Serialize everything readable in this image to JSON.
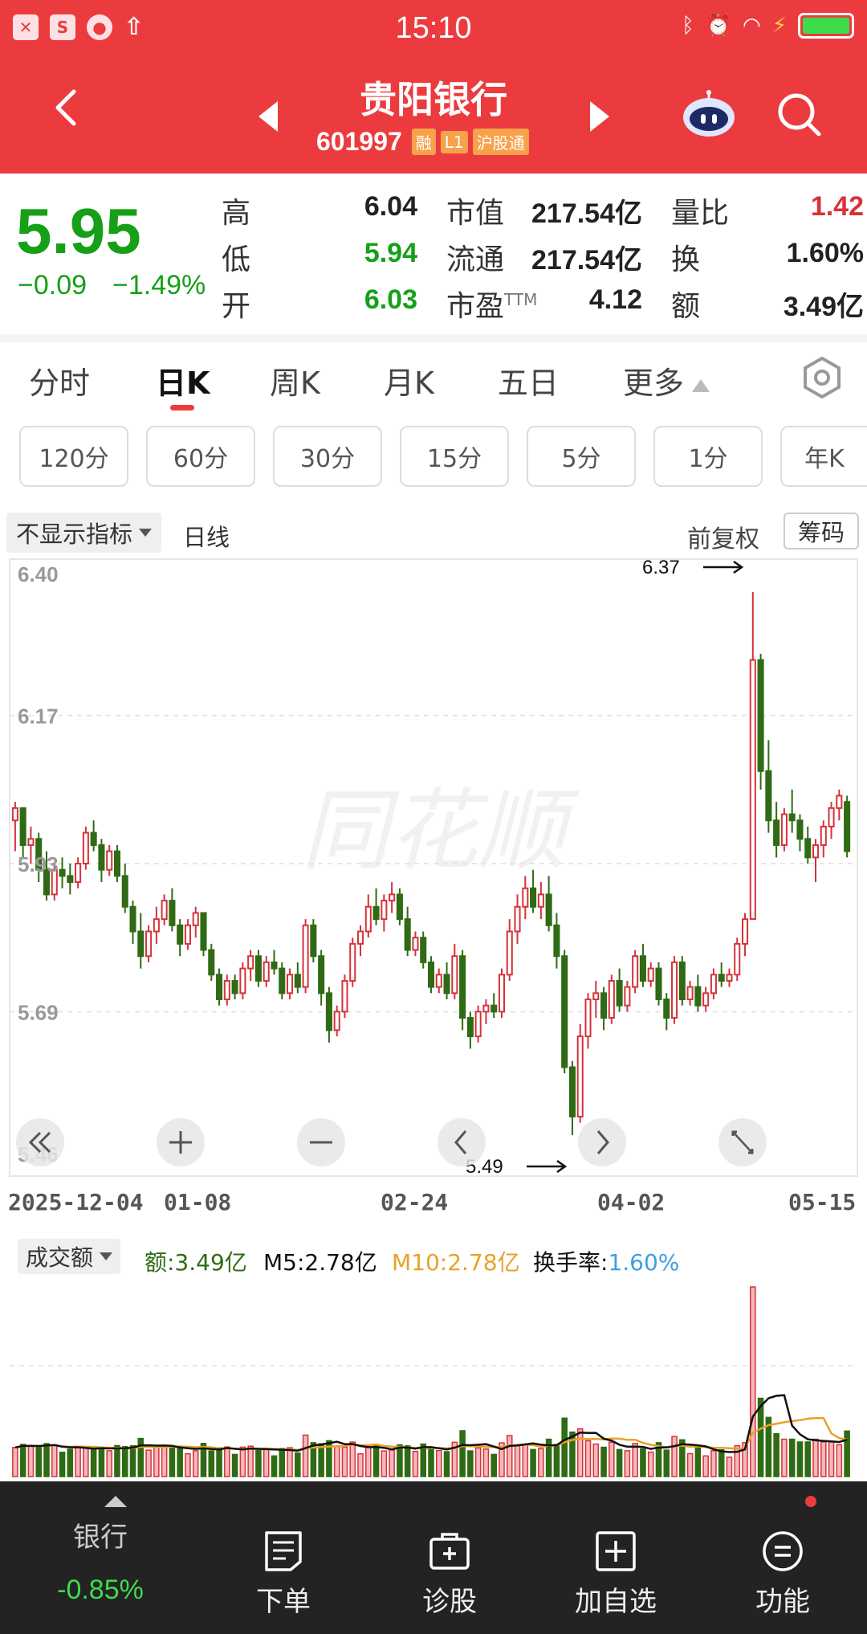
{
  "statusbar": {
    "time": "15:10",
    "icons": [
      "close-app-icon",
      "s-app-icon",
      "ball-app-icon",
      "upload-icon",
      "bluetooth-icon",
      "alarm-icon",
      "wifi-icon",
      "charging-icon",
      "battery-icon"
    ]
  },
  "header": {
    "name": "贵阳银行",
    "code": "601997",
    "tags": [
      "融",
      "L1",
      "沪股通"
    ]
  },
  "quote": {
    "price": "5.95",
    "change": "−0.09",
    "change_pct": "−1.49%",
    "rows": [
      {
        "l1": "高",
        "v1": "6.04",
        "l2": "市值",
        "v2": "217.54亿",
        "l3": "量比",
        "v3": "1.42"
      },
      {
        "l1": "低",
        "v1": "5.94",
        "l2": "流通",
        "v2": "217.54亿",
        "l3": "换",
        "v3": "1.60%"
      },
      {
        "l1": "开",
        "v1": "6.03",
        "l2": "市盈",
        "l2sup": "TTM",
        "v2": "4.12",
        "l3": "额",
        "v3": "3.49亿"
      }
    ]
  },
  "tabs": [
    "分时",
    "日K",
    "周K",
    "月K",
    "五日",
    "更多"
  ],
  "minute_buttons": [
    "120分",
    "60分",
    "30分",
    "15分",
    "5分",
    "1分",
    "年K"
  ],
  "indicator": {
    "select": "不显示指标",
    "period": "日线",
    "adjust": "前复权",
    "chips": "筹码"
  },
  "chart_data": [
    {
      "type": "candlestick",
      "y_ticks": [
        "6.40",
        "6.17",
        "5.93",
        "5.69",
        "5.46"
      ],
      "ylim": [
        5.46,
        6.4
      ],
      "x_ticks": [
        "2025-12-04",
        "01-08",
        "02-24",
        "04-02",
        "05-15"
      ],
      "max_label": "6.37",
      "min_label": "5.49",
      "watermark": "同花顺",
      "candles_ohlc": [
        [
          6.0,
          6.03,
          5.95,
          6.02
        ],
        [
          6.02,
          6.02,
          5.94,
          5.96
        ],
        [
          5.96,
          5.99,
          5.93,
          5.97
        ],
        [
          5.97,
          5.98,
          5.9,
          5.92
        ],
        [
          5.92,
          5.95,
          5.87,
          5.88
        ],
        [
          5.88,
          5.93,
          5.87,
          5.92
        ],
        [
          5.92,
          5.94,
          5.89,
          5.91
        ],
        [
          5.91,
          5.93,
          5.88,
          5.9
        ],
        [
          5.9,
          5.94,
          5.89,
          5.93
        ],
        [
          5.93,
          5.99,
          5.92,
          5.98
        ],
        [
          5.98,
          6.0,
          5.95,
          5.96
        ],
        [
          5.96,
          5.97,
          5.9,
          5.92
        ],
        [
          5.92,
          5.96,
          5.91,
          5.95
        ],
        [
          5.95,
          5.96,
          5.9,
          5.91
        ],
        [
          5.91,
          5.93,
          5.85,
          5.86
        ],
        [
          5.86,
          5.87,
          5.8,
          5.82
        ],
        [
          5.82,
          5.85,
          5.76,
          5.78
        ],
        [
          5.78,
          5.83,
          5.77,
          5.82
        ],
        [
          5.82,
          5.86,
          5.8,
          5.84
        ],
        [
          5.84,
          5.88,
          5.83,
          5.87
        ],
        [
          5.87,
          5.89,
          5.82,
          5.83
        ],
        [
          5.83,
          5.84,
          5.78,
          5.8
        ],
        [
          5.8,
          5.84,
          5.79,
          5.83
        ],
        [
          5.83,
          5.86,
          5.81,
          5.85
        ],
        [
          5.85,
          5.85,
          5.78,
          5.79
        ],
        [
          5.79,
          5.8,
          5.74,
          5.75
        ],
        [
          5.75,
          5.76,
          5.7,
          5.71
        ],
        [
          5.71,
          5.75,
          5.7,
          5.74
        ],
        [
          5.74,
          5.75,
          5.71,
          5.72
        ],
        [
          5.72,
          5.77,
          5.71,
          5.76
        ],
        [
          5.76,
          5.79,
          5.74,
          5.78
        ],
        [
          5.78,
          5.79,
          5.73,
          5.74
        ],
        [
          5.74,
          5.78,
          5.73,
          5.77
        ],
        [
          5.77,
          5.79,
          5.75,
          5.76
        ],
        [
          5.76,
          5.77,
          5.71,
          5.72
        ],
        [
          5.72,
          5.76,
          5.71,
          5.75
        ],
        [
          5.75,
          5.77,
          5.72,
          5.73
        ],
        [
          5.73,
          5.84,
          5.72,
          5.83
        ],
        [
          5.83,
          5.84,
          5.77,
          5.78
        ],
        [
          5.78,
          5.79,
          5.7,
          5.72
        ],
        [
          5.72,
          5.73,
          5.64,
          5.66
        ],
        [
          5.66,
          5.7,
          5.65,
          5.69
        ],
        [
          5.69,
          5.75,
          5.68,
          5.74
        ],
        [
          5.74,
          5.81,
          5.73,
          5.8
        ],
        [
          5.8,
          5.83,
          5.78,
          5.82
        ],
        [
          5.82,
          5.88,
          5.81,
          5.86
        ],
        [
          5.86,
          5.89,
          5.83,
          5.84
        ],
        [
          5.84,
          5.88,
          5.82,
          5.87
        ],
        [
          5.87,
          5.9,
          5.85,
          5.88
        ],
        [
          5.88,
          5.89,
          5.83,
          5.84
        ],
        [
          5.84,
          5.86,
          5.78,
          5.79
        ],
        [
          5.79,
          5.82,
          5.78,
          5.81
        ],
        [
          5.81,
          5.82,
          5.76,
          5.77
        ],
        [
          5.77,
          5.78,
          5.72,
          5.73
        ],
        [
          5.73,
          5.76,
          5.72,
          5.75
        ],
        [
          5.75,
          5.77,
          5.71,
          5.72
        ],
        [
          5.72,
          5.8,
          5.71,
          5.78
        ],
        [
          5.78,
          5.79,
          5.66,
          5.68
        ],
        [
          5.68,
          5.69,
          5.63,
          5.65
        ],
        [
          5.65,
          5.7,
          5.64,
          5.69
        ],
        [
          5.69,
          5.71,
          5.67,
          5.7
        ],
        [
          5.7,
          5.72,
          5.68,
          5.69
        ],
        [
          5.69,
          5.76,
          5.68,
          5.75
        ],
        [
          5.75,
          5.84,
          5.74,
          5.82
        ],
        [
          5.82,
          5.88,
          5.8,
          5.86
        ],
        [
          5.86,
          5.91,
          5.84,
          5.89
        ],
        [
          5.89,
          5.92,
          5.85,
          5.86
        ],
        [
          5.86,
          5.9,
          5.84,
          5.88
        ],
        [
          5.88,
          5.91,
          5.82,
          5.83
        ],
        [
          5.83,
          5.85,
          5.76,
          5.78
        ],
        [
          5.78,
          5.79,
          5.59,
          5.6
        ],
        [
          5.6,
          5.61,
          5.49,
          5.52
        ],
        [
          5.52,
          5.67,
          5.51,
          5.65
        ],
        [
          5.65,
          5.72,
          5.63,
          5.71
        ],
        [
          5.71,
          5.74,
          5.68,
          5.72
        ],
        [
          5.72,
          5.73,
          5.66,
          5.68
        ],
        [
          5.68,
          5.75,
          5.67,
          5.74
        ],
        [
          5.74,
          5.76,
          5.69,
          5.7
        ],
        [
          5.7,
          5.74,
          5.69,
          5.73
        ],
        [
          5.73,
          5.79,
          5.72,
          5.78
        ],
        [
          5.78,
          5.8,
          5.73,
          5.74
        ],
        [
          5.74,
          5.77,
          5.73,
          5.76
        ],
        [
          5.76,
          5.77,
          5.7,
          5.71
        ],
        [
          5.71,
          5.72,
          5.66,
          5.68
        ],
        [
          5.68,
          5.78,
          5.67,
          5.77
        ],
        [
          5.77,
          5.78,
          5.7,
          5.71
        ],
        [
          5.71,
          5.74,
          5.7,
          5.73
        ],
        [
          5.73,
          5.75,
          5.69,
          5.7
        ],
        [
          5.7,
          5.73,
          5.69,
          5.72
        ],
        [
          5.72,
          5.76,
          5.71,
          5.75
        ],
        [
          5.75,
          5.77,
          5.73,
          5.74
        ],
        [
          5.74,
          5.76,
          5.73,
          5.75
        ],
        [
          5.75,
          5.81,
          5.74,
          5.8
        ],
        [
          5.8,
          5.85,
          5.78,
          5.84
        ],
        [
          5.84,
          6.37,
          5.84,
          6.26
        ],
        [
          6.26,
          6.27,
          6.05,
          6.08
        ],
        [
          6.08,
          6.13,
          5.98,
          6.0
        ],
        [
          6.0,
          6.03,
          5.94,
          5.96
        ],
        [
          5.96,
          6.02,
          5.95,
          6.01
        ],
        [
          6.01,
          6.05,
          5.98,
          6.0
        ],
        [
          6.0,
          6.01,
          5.95,
          5.97
        ],
        [
          5.97,
          5.99,
          5.93,
          5.94
        ],
        [
          5.94,
          5.97,
          5.9,
          5.96
        ],
        [
          5.96,
          6.0,
          5.94,
          5.99
        ],
        [
          5.99,
          6.03,
          5.97,
          6.02
        ],
        [
          6.02,
          6.05,
          6.0,
          6.04
        ],
        [
          6.03,
          6.04,
          5.94,
          5.95
        ]
      ]
    },
    {
      "type": "bar",
      "title": "成交额",
      "series": [
        {
          "name": "额",
          "current": "3.49亿"
        },
        {
          "name": "M5",
          "current": "2.78亿"
        },
        {
          "name": "M10",
          "current": "2.78亿"
        },
        {
          "name": "换手率",
          "current": "1.60%"
        }
      ]
    }
  ],
  "volume": {
    "select": "成交额",
    "amount_label": "额:3.49亿",
    "m5_label": "M5:2.78亿",
    "m10_label": "M10:2.78亿",
    "turnover_label": "换手率:",
    "turnover_value": "1.60%"
  },
  "bottom_nav": {
    "sector": {
      "name": "银行",
      "change": "-0.85%"
    },
    "items": [
      "下单",
      "诊股",
      "加自选",
      "功能"
    ]
  },
  "colors": {
    "brand": "#ec3b3f",
    "up": "#d6323a",
    "down": "#2f6b14",
    "price_down": "#16a018",
    "m5": "#111111",
    "m10": "#e9a12a",
    "turnover": "#3aa0e0"
  }
}
